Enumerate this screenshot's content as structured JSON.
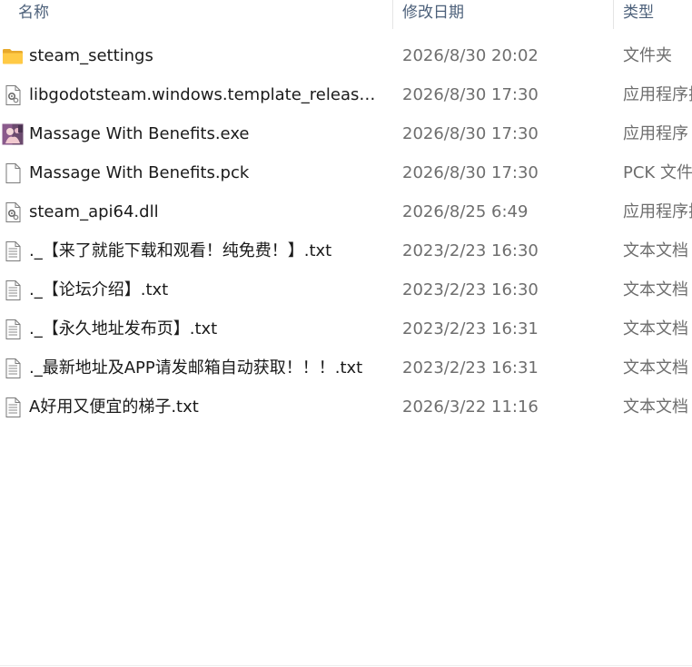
{
  "columns": {
    "name": "名称",
    "date": "修改日期",
    "type": "类型"
  },
  "files": [
    {
      "icon": "folder-icon",
      "name": "steam_settings",
      "date": "2026/8/30 20:02",
      "type": "文件夹"
    },
    {
      "icon": "dll-gear-file-icon",
      "name": "libgodotsteam.windows.template_release.x...",
      "date": "2026/8/30 17:30",
      "type": "应用程序扩展"
    },
    {
      "icon": "app-thumbnail-icon",
      "name": "Massage With Benefits.exe",
      "date": "2026/8/30 17:30",
      "type": "应用程序"
    },
    {
      "icon": "blank-file-icon",
      "name": "Massage With Benefits.pck",
      "date": "2026/8/30 17:30",
      "type": "PCK 文件"
    },
    {
      "icon": "dll-gear-file-icon",
      "name": "steam_api64.dll",
      "date": "2026/8/25 6:49",
      "type": "应用程序扩展"
    },
    {
      "icon": "text-file-icon",
      "name": "._【来了就能下载和观看！纯免费！】.txt",
      "date": "2023/2/23 16:30",
      "type": "文本文档"
    },
    {
      "icon": "text-file-icon",
      "name": "._【论坛介绍】.txt",
      "date": "2023/2/23 16:30",
      "type": "文本文档"
    },
    {
      "icon": "text-file-icon",
      "name": "._【永久地址发布页】.txt",
      "date": "2023/2/23 16:31",
      "type": "文本文档"
    },
    {
      "icon": "text-file-icon",
      "name": "._最新地址及APP请发邮箱自动获取！！！.txt",
      "date": "2023/2/23 16:31",
      "type": "文本文档"
    },
    {
      "icon": "text-file-icon",
      "name": "A好用又便宜的梯子.txt",
      "date": "2026/3/22 11:16",
      "type": "文本文档"
    }
  ]
}
